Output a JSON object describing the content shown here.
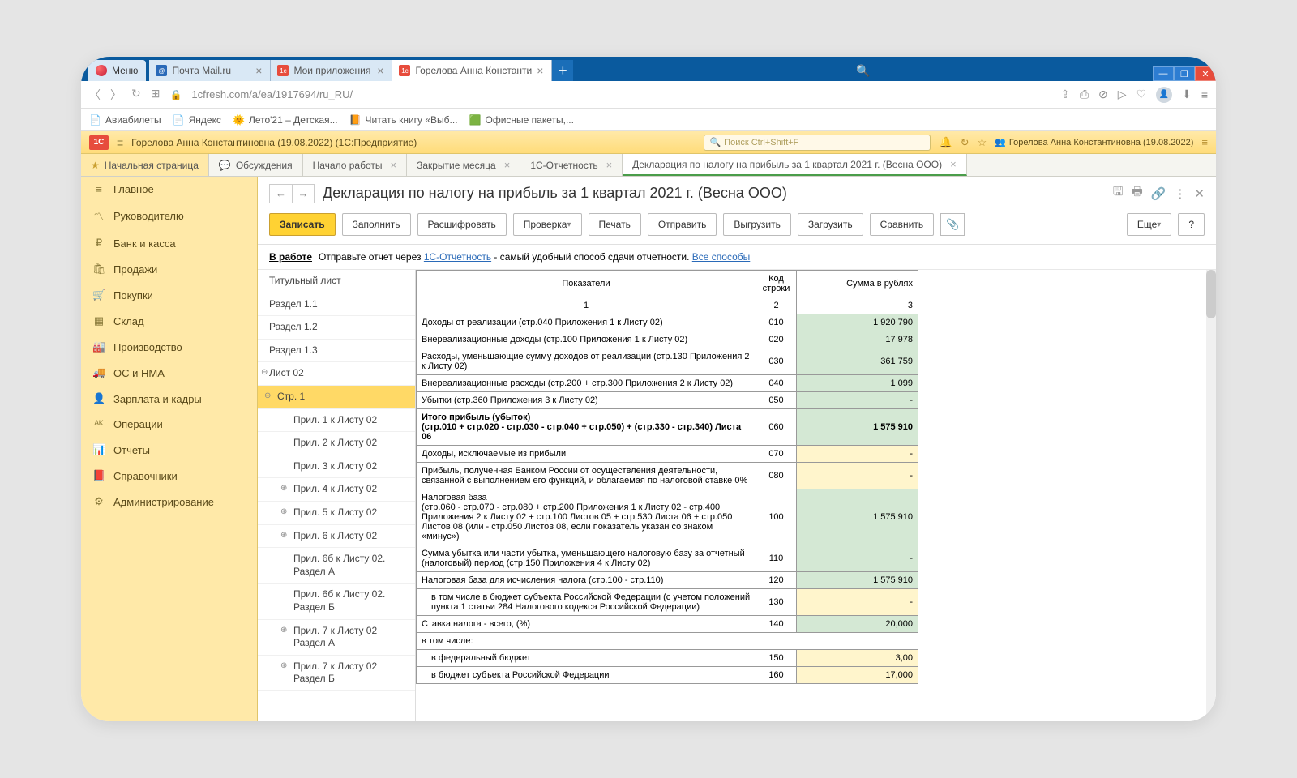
{
  "browser": {
    "menu": "Меню",
    "tabs": [
      {
        "icon": "mail",
        "iconColor": "#2a6ab8",
        "label": "Почта Mail.ru"
      },
      {
        "icon": "1c",
        "iconColor": "#e74c3c",
        "label": "Мои приложения"
      },
      {
        "icon": "1c",
        "iconColor": "#e74c3c",
        "label": "Горелова Анна Константи",
        "active": true
      }
    ],
    "url": "1cfresh.com/a/ea/1917694/ru_RU/",
    "bookmarks": [
      {
        "icon": "📄",
        "label": "Авиабилеты"
      },
      {
        "icon": "📄",
        "label": "Яндекс"
      },
      {
        "icon": "🌞",
        "label": "Лето'21 – Детская..."
      },
      {
        "icon": "📙",
        "label": "Читать книгу «Выб..."
      },
      {
        "icon": "🟩",
        "label": "Офисные пакеты,..."
      }
    ]
  },
  "app": {
    "title": "Горелова Анна Константиновна (19.08.2022)  (1С:Предприятие)",
    "search_placeholder": "Поиск Ctrl+Shift+F",
    "user": "Горелова Анна Константиновна (19.08.2022)",
    "tabs": [
      {
        "label": "Начальная страница",
        "home": true
      },
      {
        "icon": "💬",
        "label": "Обсуждения"
      },
      {
        "label": "Начало работы",
        "closable": true
      },
      {
        "label": "Закрытие месяца",
        "closable": true
      },
      {
        "label": "1С-Отчетность",
        "closable": true
      },
      {
        "label": "Декларация по налогу на прибыль за 1 квартал 2021 г. (Весна ООО)",
        "closable": true,
        "active": true
      }
    ]
  },
  "sidebar": [
    {
      "icon": "≡",
      "label": "Главное"
    },
    {
      "icon": "〽",
      "label": "Руководителю"
    },
    {
      "icon": "₽",
      "label": "Банк и касса"
    },
    {
      "icon": "🛍",
      "label": "Продажи"
    },
    {
      "icon": "🛒",
      "label": "Покупки"
    },
    {
      "icon": "▦",
      "label": "Склад"
    },
    {
      "icon": "🏭",
      "label": "Производство"
    },
    {
      "icon": "🚚",
      "label": "ОС и НМА"
    },
    {
      "icon": "👤",
      "label": "Зарплата и кадры"
    },
    {
      "icon": "ᴬᴷ",
      "label": "Операции"
    },
    {
      "icon": "📊",
      "label": "Отчеты"
    },
    {
      "icon": "📕",
      "label": "Справочники"
    },
    {
      "icon": "⚙",
      "label": "Администрирование"
    }
  ],
  "page": {
    "title": "Декларация по налогу на прибыль за 1 квартал 2021 г. (Весна ООО)",
    "toolbar": {
      "save": "Записать",
      "fill": "Заполнить",
      "decrypt": "Расшифровать",
      "check": "Проверка",
      "print": "Печать",
      "send": "Отправить",
      "upload": "Выгрузить",
      "download": "Загрузить",
      "compare": "Сравнить",
      "more": "Еще",
      "help": "?"
    },
    "status": {
      "work": "В работе",
      "text1": "Отправьте отчет через ",
      "link1": "1С-Отчетность",
      "text2": " - самый удобный способ сдачи отчетности. ",
      "link2": "Все способы"
    }
  },
  "tree": [
    {
      "label": "Титульный лист",
      "level": 0
    },
    {
      "label": "Раздел 1.1",
      "level": 0
    },
    {
      "label": "Раздел 1.2",
      "level": 0
    },
    {
      "label": "Раздел 1.3",
      "level": 0
    },
    {
      "label": "Лист 02",
      "level": 0,
      "exp": "⊖"
    },
    {
      "label": "Стр. 1",
      "level": 1,
      "exp": "⊖",
      "sel": true
    },
    {
      "label": "Прил. 1 к Листу 02",
      "level": 2
    },
    {
      "label": "Прил. 2 к Листу 02",
      "level": 2
    },
    {
      "label": "Прил. 3 к Листу 02",
      "level": 2
    },
    {
      "label": "Прил. 4 к Листу 02",
      "level": 2,
      "exp": "⊕"
    },
    {
      "label": "Прил. 5 к Листу 02",
      "level": 2,
      "exp": "⊕"
    },
    {
      "label": "Прил. 6 к Листу 02",
      "level": 2,
      "exp": "⊕"
    },
    {
      "label": "Прил. 6б к Листу 02. Раздел А",
      "level": 2
    },
    {
      "label": "Прил. 6б к Листу 02. Раздел Б",
      "level": 2
    },
    {
      "label": "Прил. 7 к Листу 02 Раздел А",
      "level": 2,
      "exp": "⊕"
    },
    {
      "label": "Прил. 7 к Листу 02 Раздел Б",
      "level": 2,
      "exp": "⊕"
    }
  ],
  "grid": {
    "headers": {
      "indicators": "Показатели",
      "code": "Код строки",
      "sum": "Сумма в рублях",
      "c1": "1",
      "c2": "2",
      "c3": "3"
    },
    "rows": [
      {
        "name": "Доходы от реализации (стр.040 Приложения 1 к Листу 02)",
        "code": "010",
        "val": "1 920 790",
        "cls": "green"
      },
      {
        "name": "Внереализационные доходы (стр.100 Приложения 1 к Листу 02)",
        "code": "020",
        "val": "17 978",
        "cls": "green"
      },
      {
        "name": "Расходы, уменьшающие сумму доходов от реализации (стр.130 Приложения 2 к Листу 02)",
        "code": "030",
        "val": "361 759",
        "cls": "green"
      },
      {
        "name": "Внереализационные расходы (стр.200 + стр.300 Приложения 2 к Листу 02)",
        "code": "040",
        "val": "1 099",
        "cls": "green"
      },
      {
        "name": "Убытки (стр.360 Приложения 3 к Листу 02)",
        "code": "050",
        "val": "-",
        "cls": "green"
      },
      {
        "name": "Итого прибыль (убыток)\n(стр.010 + стр.020 - стр.030 - стр.040 + стр.050) + (стр.330 - стр.340) Листа 06",
        "code": "060",
        "val": "1 575 910",
        "cls": "green",
        "bold": true
      },
      {
        "name": "Доходы, исключаемые из прибыли",
        "code": "070",
        "val": "-",
        "cls": "yellow"
      },
      {
        "name": "Прибыль, полученная Банком России от осуществления деятельности, связанной с выполнением его функций, и облагаемая по налоговой ставке 0%",
        "code": "080",
        "val": "-",
        "cls": "yellow"
      },
      {
        "name": "Налоговая база\n(стр.060 - стр.070 - стр.080 + стр.200 Приложения 1 к Листу 02 - стр.400 Приложения 2 к Листу 02 + стр.100 Листов 05 + стр.530 Листа 06 + стр.050 Листов 08 (или - стр.050 Листов 08, если показатель указан со знаком «минус»)",
        "code": "100",
        "val": "1 575 910",
        "cls": "green"
      },
      {
        "name": "Сумма убытка или части убытка, уменьшающего налоговую базу за отчетный (налоговый) период (стр.150 Приложения 4 к Листу 02)",
        "code": "110",
        "val": "-",
        "cls": "green"
      },
      {
        "name": "Налоговая база для исчисления налога (стр.100 - стр.110)",
        "code": "120",
        "val": "1 575 910",
        "cls": "green"
      },
      {
        "name": "в том числе в бюджет субъекта Российской Федерации (с учетом положений пункта 1 статьи 284 Налогового кодекса Российской Федерации)",
        "code": "130",
        "val": "-",
        "cls": "yellow",
        "sub": true
      },
      {
        "name": "Ставка налога - всего, (%)",
        "code": "140",
        "val": "20,000",
        "cls": "green"
      },
      {
        "name": "в том числе:",
        "code": "",
        "val": "",
        "plain": true
      },
      {
        "name": "в федеральный бюджет",
        "code": "150",
        "val": "3,00",
        "cls": "yellow",
        "sub": true
      },
      {
        "name": "в бюджет субъекта Российской Федерации",
        "code": "160",
        "val": "17,000",
        "cls": "yellow",
        "sub": true
      }
    ]
  }
}
